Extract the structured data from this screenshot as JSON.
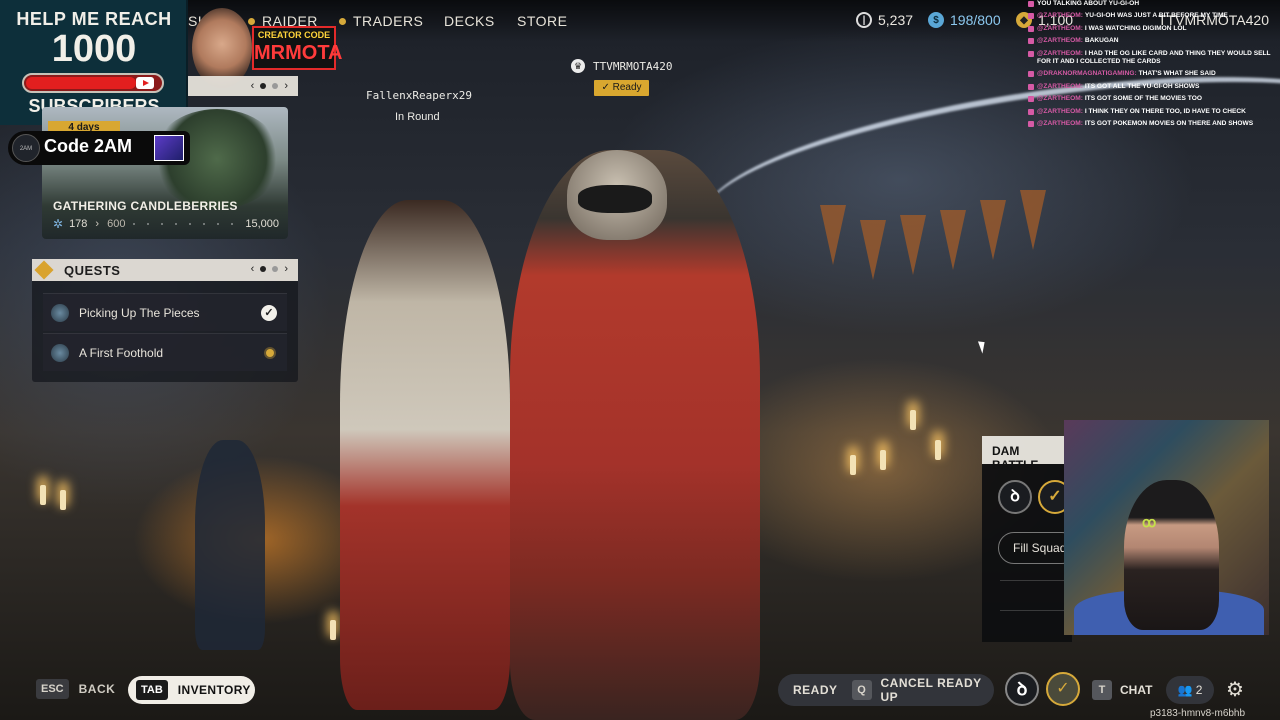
{
  "stream_overlay": {
    "sub_goal_line1": "HELP ME REACH",
    "sub_goal_number": "1000",
    "sub_goal_line3": "SUBSCRIBERS",
    "sub_goal_progress": 0.82,
    "creator_code_label": "CREATOR CODE",
    "creator_code_name": "MRMOTA",
    "promo_code": "Code 2AM"
  },
  "topnav": {
    "items": [
      {
        "label": "SH"
      },
      {
        "label": "RAIDER"
      },
      {
        "label": "TRADERS"
      },
      {
        "label": "DECKS"
      },
      {
        "label": "STORE"
      }
    ],
    "currency_coins": "5,237",
    "raider_tokens": "198/800",
    "cred": "1,100",
    "username": "TTVMRMOTA420"
  },
  "event": {
    "days_left": "4 days",
    "title": "GATHERING CANDLEBERRIES",
    "progress_current": "178",
    "progress_next": "600",
    "progress_max": "15,000"
  },
  "quests": {
    "title": "QUESTS",
    "items": [
      {
        "label": "Picking Up The Pieces",
        "status": "complete"
      },
      {
        "label": "A First Foothold",
        "status": "active"
      }
    ]
  },
  "players": {
    "left_name": "FallenxReaperx29",
    "left_status": "In Round",
    "right_name": "TTVMRMOTA420",
    "right_status": "Ready"
  },
  "chat": [
    {
      "user": "",
      "msg": "YOU TALKING ABOUT YU-GI-OH"
    },
    {
      "user": "@ZARTHEOM:",
      "msg": "YU-GI-OH WAS JUST A BIT BEFORE MY TIME"
    },
    {
      "user": "@ZARTHEOM:",
      "msg": "I WAS WATCHING DIGIMON LOL"
    },
    {
      "user": "@ZARTHEOM:",
      "msg": "BAKUGAN"
    },
    {
      "user": "@ZARTHEOM:",
      "msg": "I HAD THE OG LIKE CARD AND THING THEY WOULD SELL FOR IT AND I COLLECTED THE CARDS"
    },
    {
      "user": "@DRAKNORMAGNATIGAMING:",
      "msg": "THAT'S WHAT SHE SAID"
    },
    {
      "user": "@ZARTHEOM:",
      "msg": "ITS GOT ALL THE YU-GI-OH SHOWS"
    },
    {
      "user": "@ZARTHEOM:",
      "msg": "ITS GOT SOME OF THE MOVIES TOO"
    },
    {
      "user": "@ZARTHEOM:",
      "msg": "I THINK THEY ON THERE TOO, ID HAVE TO CHECK"
    },
    {
      "user": "@ZARTHEOM:",
      "msg": "ITS GOT POKEMON MOVIES ON THERE AND SHOWS"
    }
  ],
  "squad_panel": {
    "title": "DAM BATTLE",
    "fill_squad_label": "Fill Squad"
  },
  "bottom_bar": {
    "back_key": "ESC",
    "back_label": "BACK",
    "inventory_key": "TAB",
    "inventory_label": "INVENTORY",
    "ready_label": "READY",
    "cancel_key": "Q",
    "cancel_label": "CANCEL READY UP",
    "chat_key": "T",
    "chat_label": "CHAT",
    "party_count": "2",
    "session_id": "p3183-hmnv8-m6bhb"
  }
}
